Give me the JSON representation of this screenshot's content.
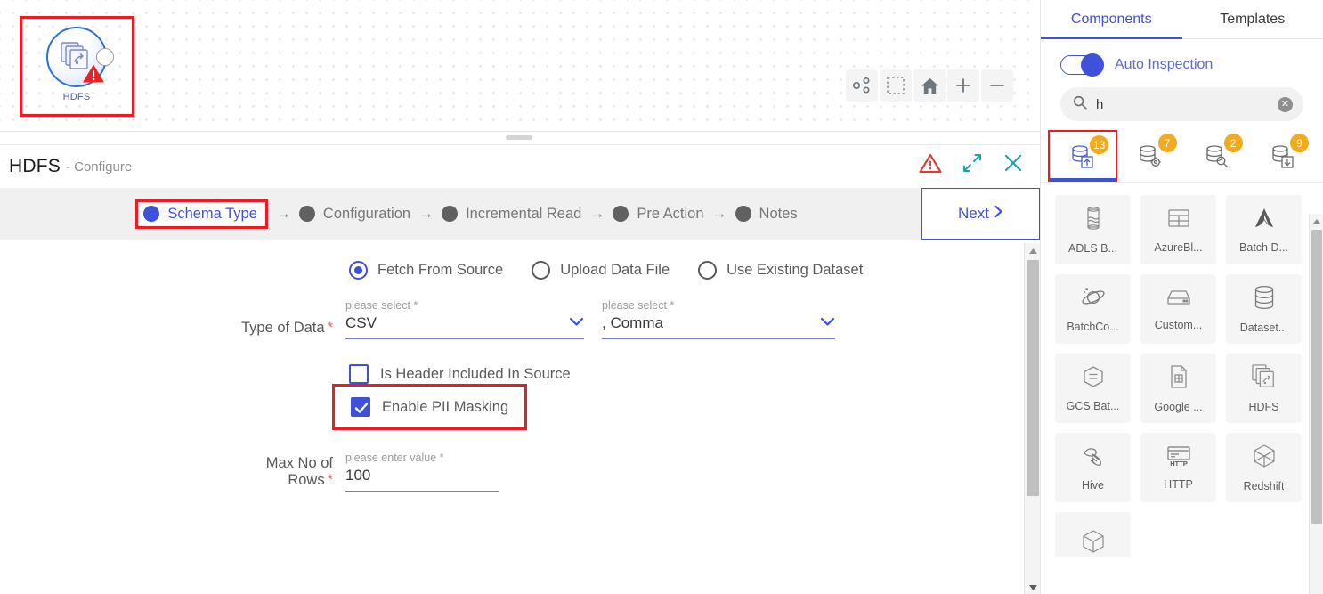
{
  "canvas": {
    "node": {
      "label": "HDFS",
      "icon": "copy-stack-icon",
      "has_warning": true
    },
    "toolbar": [
      {
        "name": "auto-layout-icon",
        "title": "Auto Layout"
      },
      {
        "name": "selection-box-icon",
        "title": "Select Area"
      },
      {
        "name": "home-icon",
        "title": "Reset View"
      },
      {
        "name": "zoom-in-icon",
        "title": "Zoom In"
      },
      {
        "name": "zoom-out-icon",
        "title": "Zoom Out"
      }
    ]
  },
  "dialog": {
    "title": "HDFS",
    "subtitle": "- Configure",
    "actions": [
      {
        "name": "warning-icon",
        "color": "#e8352e"
      },
      {
        "name": "expand-icon",
        "color": "#17a2b0"
      },
      {
        "name": "close-icon",
        "color": "#17a2b0"
      }
    ],
    "steps": [
      {
        "label": "Schema Type",
        "active": true,
        "highlighted": true
      },
      {
        "label": "Configuration",
        "active": false,
        "highlighted": false
      },
      {
        "label": "Incremental Read",
        "active": false,
        "highlighted": false
      },
      {
        "label": "Pre Action",
        "active": false,
        "highlighted": false
      },
      {
        "label": "Notes",
        "active": false,
        "highlighted": false
      }
    ],
    "step_arrow": "→",
    "next_label": "Next",
    "next_chevron": "›",
    "form": {
      "source_options": [
        {
          "label": "Fetch From Source",
          "selected": true
        },
        {
          "label": "Upload Data File",
          "selected": false
        },
        {
          "label": "Use Existing Dataset",
          "selected": false
        }
      ],
      "type_of_data": {
        "label": "Type of Data",
        "required": true,
        "format": {
          "placeholder": "please select *",
          "value": "CSV"
        },
        "delimiter": {
          "placeholder": "please select *",
          "value": ", Comma"
        }
      },
      "checkboxes": [
        {
          "label": "Is Header Included In Source",
          "checked": false,
          "highlighted": false
        },
        {
          "label": "Enable PII Masking",
          "checked": true,
          "highlighted": true
        }
      ],
      "max_rows": {
        "label": "Max No of Rows",
        "required": true,
        "placeholder": "please enter value *",
        "value": "100"
      }
    }
  },
  "right_panel": {
    "tabs": [
      {
        "label": "Components",
        "active": true
      },
      {
        "label": "Templates",
        "active": false
      }
    ],
    "auto_inspection": {
      "label": "Auto Inspection",
      "enabled": true
    },
    "search": {
      "value": "h",
      "placeholder": "",
      "icon": "search-icon",
      "clear_icon": "clear-icon"
    },
    "categories": [
      {
        "icon": "database-upload-icon",
        "badge": "13",
        "selected": true
      },
      {
        "icon": "database-settings-icon",
        "badge": "7",
        "selected": false
      },
      {
        "icon": "database-search-icon",
        "badge": "2",
        "selected": false
      },
      {
        "icon": "database-download-icon",
        "badge": "9",
        "selected": false
      }
    ],
    "components": [
      {
        "name": "ADLS B...",
        "icon": "storage-barrel-icon"
      },
      {
        "name": "AzureBl...",
        "icon": "table-grid-icon"
      },
      {
        "name": "Batch D...",
        "icon": "arrow-peak-icon"
      },
      {
        "name": "BatchCo...",
        "icon": "planet-icon"
      },
      {
        "name": "Custom...",
        "icon": "drive-icon"
      },
      {
        "name": "Dataset...",
        "icon": "database-icon"
      },
      {
        "name": "GCS Bat...",
        "icon": "hexagon-icon"
      },
      {
        "name": "Google ...",
        "icon": "document-sheet-icon"
      },
      {
        "name": "HDFS",
        "icon": "copy-stack-icon"
      },
      {
        "name": "Hive",
        "icon": "hive-bee-icon"
      },
      {
        "name": "HTTP",
        "icon": "http-card-icon"
      },
      {
        "name": "Redshift",
        "icon": "cube-icon"
      },
      {
        "name": "",
        "icon": "cube-icon"
      }
    ]
  }
}
